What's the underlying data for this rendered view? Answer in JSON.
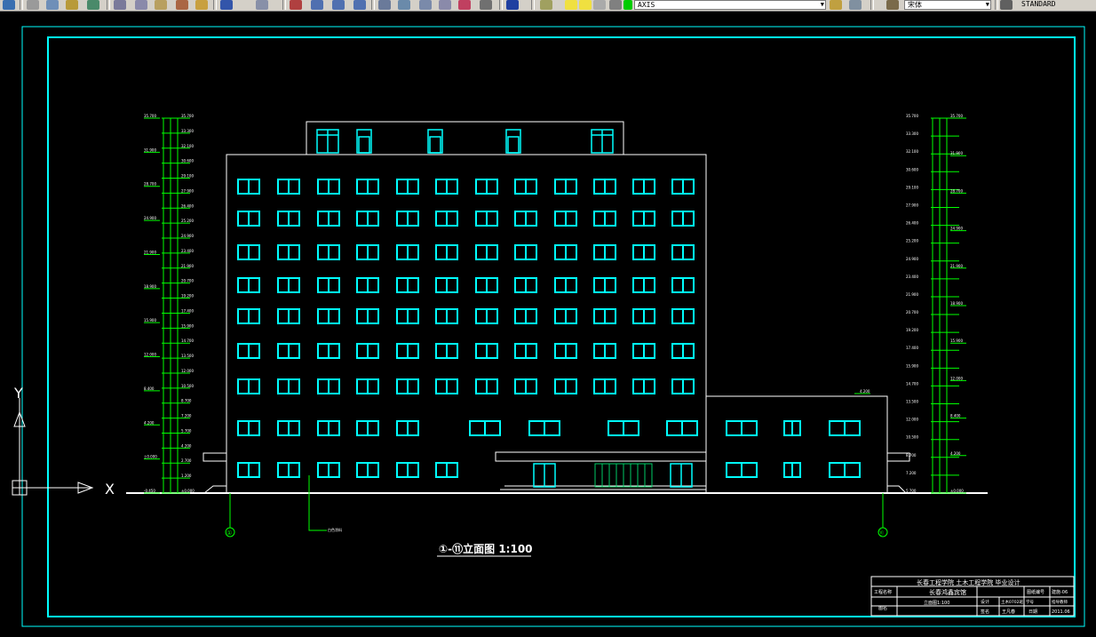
{
  "toolbar": {
    "layer_combo": "AXIS",
    "font_combo": "宋体",
    "style_combo": "STANDARD"
  },
  "drawing": {
    "axis_y": "Y",
    "axis_x": "X",
    "title": "①-⑪立面图 1:100",
    "axis_mark_left": "①",
    "axis_mark_right": "⑪",
    "leader_label": "白色涂料",
    "roof_elevation": "4.200",
    "left_dims": [
      "35.700",
      "33.300",
      "32.100",
      "30.600",
      "29.100",
      "27.900",
      "26.400",
      "25.200",
      "24.900",
      "23.400",
      "21.900",
      "20.700",
      "19.200",
      "17.400",
      "15.900",
      "14.700",
      "13.500",
      "12.000",
      "10.500",
      "8.700",
      "7.200",
      "5.700",
      "4.200",
      "2.700",
      "1.200",
      "±0.000"
    ],
    "left_levels": [
      "35.700",
      "31.900",
      "28.700",
      "24.900",
      "21.900",
      "18.900",
      "15.900",
      "12.000",
      "8.400",
      "4.200",
      "±0.000",
      "-0.450"
    ],
    "right_levels": [
      "35.700",
      "31.900",
      "28.700",
      "24.900",
      "21.900",
      "18.900",
      "15.900",
      "12.000",
      "8.400",
      "4.200",
      "±0.000"
    ]
  },
  "title_block": {
    "school": "长春工程学院 土木工程学院 毕业设计",
    "project_label": "工程名称",
    "project_name": "长春鸿鑫宾馆",
    "drawing_label": "图名",
    "drawing_name": "立面图1:100",
    "sheet_no_label": "图纸编号",
    "sheet_no": "建施-06",
    "designer_label": "设计",
    "designer": "土木0702班",
    "student_no_label": "学号",
    "student_no": "0711111013",
    "instructor_label": "指导教师",
    "sign_label": "签名",
    "sign": "王凡春",
    "date_label": "日期",
    "date": "2011.06"
  },
  "colors": {
    "frame": "#00ffff",
    "cad_white": "#ffffff",
    "cad_green": "#00ff00",
    "window": "#00ffff"
  }
}
